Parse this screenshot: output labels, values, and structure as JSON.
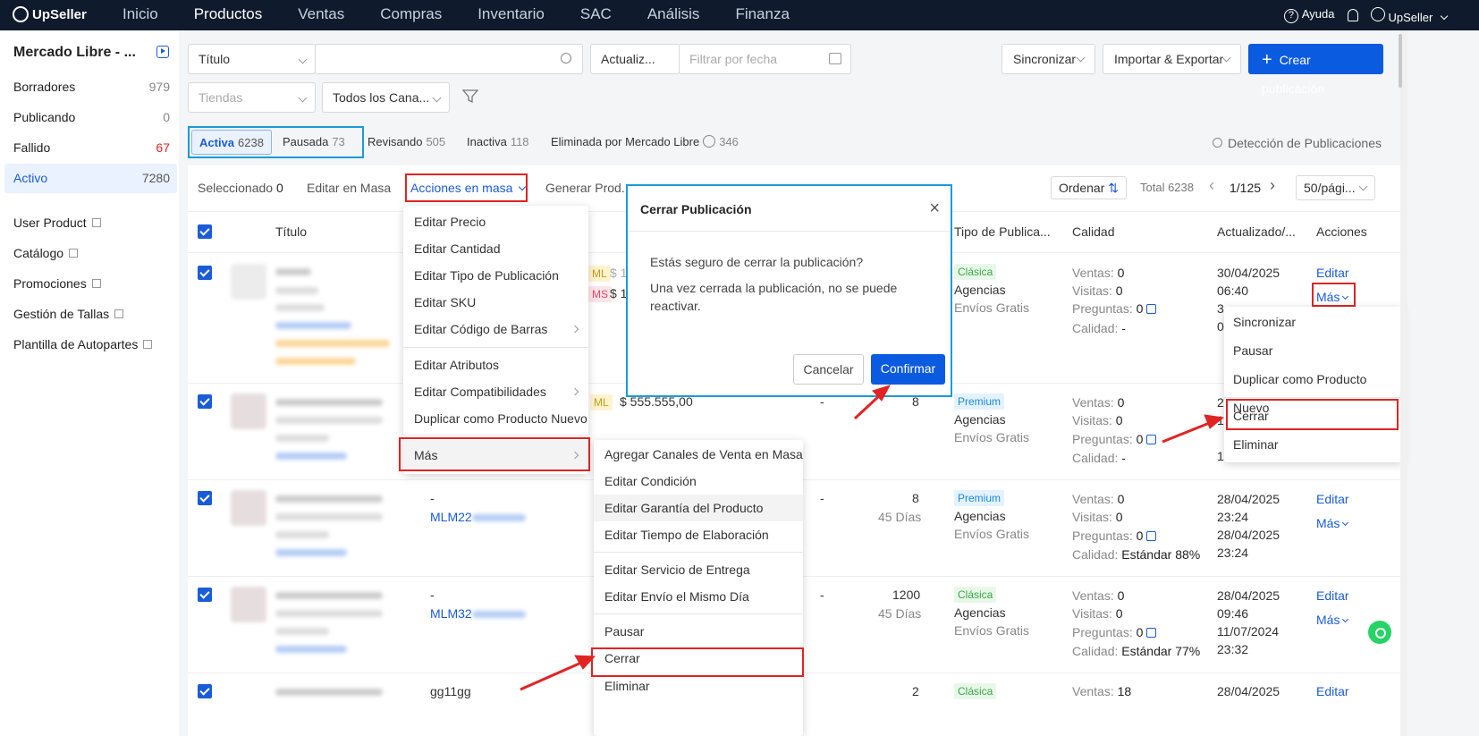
{
  "nav": {
    "logo": "UpSeller",
    "items": [
      "Inicio",
      "Productos",
      "Ventas",
      "Compras",
      "Inventario",
      "SAC",
      "Análisis",
      "Finanza"
    ],
    "active": "Productos",
    "help": "Ayuda",
    "user": "UpSeller"
  },
  "sidebar": {
    "title": "Mercado Libre - ...",
    "items": [
      {
        "label": "Borradores",
        "count": "979"
      },
      {
        "label": "Publicando",
        "count": "0"
      },
      {
        "label": "Fallido",
        "count": "67"
      },
      {
        "label": "Activo",
        "count": "7280"
      }
    ],
    "links": [
      "User Product",
      "Catálogo",
      "Promociones",
      "Gestión de Tallas",
      "Plantilla de Autopartes"
    ]
  },
  "filters": {
    "field_select": "Título",
    "search_placeholder": "",
    "date_select": "Actualiz...",
    "date_placeholder": "Filtrar por fecha",
    "stores_placeholder": "Tiendas",
    "channels_select": "Todos los Cana...",
    "sync_label": "Sincronizar",
    "import_export_label": "Importar & Exportar",
    "create_label": "Crear publicación"
  },
  "tabs": [
    {
      "label": "Activa",
      "count": "6238"
    },
    {
      "label": "Pausada",
      "count": "73"
    },
    {
      "label": "Revisando",
      "count": "505"
    },
    {
      "label": "Inactiva",
      "count": "118"
    },
    {
      "label": "Eliminada por Mercado Libre",
      "count": "346"
    }
  ],
  "detection_label": "Detección de Publicaciones",
  "toolbar": {
    "selected_label": "Seleccionado",
    "selected_count": "0",
    "bulk_edit": "Editar en Masa",
    "bulk_actions": "Acciones en masa",
    "generate": "Generar Prod.",
    "sort": "Ordenar",
    "total": "Total 6238",
    "page": "1/125",
    "per_page": "50/pági..."
  },
  "columns": {
    "title": "Título",
    "pub_type": "Tipo de Publica...",
    "quality": "Calidad",
    "updated": "Actualizado/...",
    "actions": "Acciones"
  },
  "rows": [
    {
      "id_prefix": "",
      "prices": [
        "$ 1",
        "$ 1"
      ],
      "stock": "",
      "days": "",
      "type": "Clásica",
      "agency": "Agencias",
      "shipping": "Envíos Gratis",
      "ventas": "0",
      "visitas": "0",
      "preguntas": "0",
      "calidad": "-",
      "date1": "30/04/2025",
      "time1": "06:40",
      "date2": "3",
      "time2": "0"
    },
    {
      "id_prefix": "",
      "price": "$ 555.555,00",
      "dash": "-",
      "stock": "8",
      "days": "",
      "type": "Premium",
      "agency": "Agencias",
      "shipping": "Envíos Gratis",
      "ventas": "0",
      "visitas": "0",
      "preguntas": "0",
      "calidad": "-",
      "date1": "2",
      "time1": "1",
      "date2": "",
      "time2": "1"
    },
    {
      "id_prefix": "MLM22",
      "lead": "-",
      "dash": "-",
      "stock": "8",
      "days": "45 Días",
      "type": "Premium",
      "agency": "Agencias",
      "shipping": "Envíos Gratis",
      "ventas": "0",
      "visitas": "0",
      "preguntas": "0",
      "calidad": "Estándar 88%",
      "date1": "28/04/2025",
      "time1": "23:24",
      "date2": "28/04/2025",
      "time2": "23:24"
    },
    {
      "id_prefix": "MLM32",
      "lead": "-",
      "dash": "-",
      "stock": "1200",
      "days": "45 Días",
      "type": "Clásica",
      "agency": "Agencias",
      "shipping": "Envíos Gratis",
      "ventas": "0",
      "visitas": "0",
      "preguntas": "0",
      "calidad": "Estándar 77%",
      "date1": "28/04/2025",
      "time1": "09:46",
      "date2": "11/07/2024",
      "time2": "23:32"
    },
    {
      "id_prefix": "gg11gg",
      "stock": "2",
      "type": "Clásica",
      "ventas": "18",
      "date1": "28/04/2025"
    }
  ],
  "labels": {
    "ventas": "Ventas:",
    "visitas": "Visitas:",
    "preguntas": "Preguntas:",
    "calidad": "Calidad:",
    "editar": "Editar",
    "mas": "Más",
    "ml": "ML",
    "ms": "MS"
  },
  "bulk_menu": {
    "group1": [
      "Editar Precio",
      "Editar Cantidad",
      "Editar Tipo de Publicación",
      "Editar SKU",
      "Editar Código de Barras"
    ],
    "group2": [
      "Editar Atributos",
      "Editar Compatibilidades",
      "Duplicar como Producto Nuevo"
    ],
    "more": "Más"
  },
  "more_submenu": {
    "group1": [
      "Agregar Canales de Venta en Masa",
      "Editar Condición",
      "Editar Garantía del Producto",
      "Editar Tiempo de Elaboración"
    ],
    "group2": [
      "Editar Servicio de Entrega",
      "Editar Envío el Mismo Día"
    ],
    "group3": [
      "Pausar",
      "Cerrar",
      "Eliminar"
    ]
  },
  "row_menu": [
    "Sincronizar",
    "Pausar",
    "Duplicar como Producto Nuevo",
    "Cerrar",
    "Eliminar"
  ],
  "modal": {
    "title": "Cerrar Publicación",
    "question": "Estás seguro de cerrar la publicación?",
    "warning": "Una vez cerrada la publicación, no se puede reactivar.",
    "cancel": "Cancelar",
    "confirm": "Confirmar"
  },
  "colors": {
    "accent": "#0b5be0",
    "highlight_red": "#e02424",
    "highlight_blue": "#1a9bd8",
    "nav_bg": "#0f1b2d"
  }
}
